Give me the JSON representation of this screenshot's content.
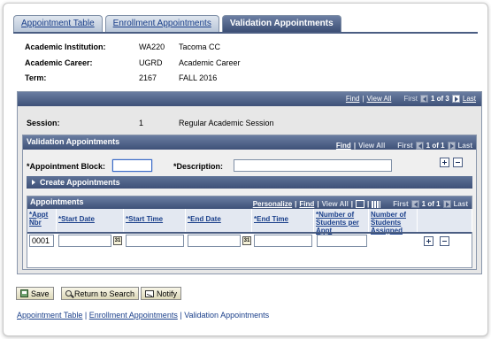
{
  "tabs": [
    {
      "label": "Appointment Table"
    },
    {
      "label": "Enrollment Appointments"
    },
    {
      "label": "Validation Appointments"
    }
  ],
  "header": {
    "institution_label": "Academic Institution:",
    "institution_code": "WA220",
    "institution_name": "Tacoma CC",
    "career_label": "Academic Career:",
    "career_code": "UGRD",
    "career_name": "Academic Career",
    "term_label": "Term:",
    "term_code": "2167",
    "term_name": "FALL 2016"
  },
  "outer_nav": {
    "find": "Find",
    "view_all": "View All",
    "first": "First",
    "count": "1 of 3",
    "last": "Last"
  },
  "session": {
    "label": "Session:",
    "number": "1",
    "description": "Regular Academic Session"
  },
  "validation": {
    "title": "Validation Appointments",
    "nav": {
      "find": "Find",
      "view_all": "View All",
      "first": "First",
      "count": "1 of 1",
      "last": "Last"
    },
    "block_label": "*Appointment Block:",
    "block_value": "",
    "desc_label": "*Description:",
    "desc_value": "",
    "create_label": "Create Appointments"
  },
  "appointments": {
    "title": "Appointments",
    "nav": {
      "personalize": "Personalize",
      "find": "Find",
      "view_all": "View All",
      "first": "First",
      "count": "1 of 1",
      "last": "Last"
    },
    "columns": [
      "*Appt Nbr",
      "*Start Date",
      "*Start Time",
      "*End Date",
      "*End Time",
      "*Number of Students per Appt",
      "Number of Students Assigned"
    ],
    "rows": [
      {
        "appt_nbr": "0001",
        "start_date": "",
        "start_time": "",
        "end_date": "",
        "end_time": "",
        "students_per_appt": "",
        "students_assigned": ""
      }
    ]
  },
  "toolbar": {
    "save": "Save",
    "return": "Return to Search",
    "notify": "Notify"
  },
  "footer": {
    "link1": "Appointment Table",
    "sep": "|",
    "link2": "Enrollment Appointments",
    "current": "Validation Appointments"
  },
  "colors": {
    "bar_dark": "#3e5178",
    "link": "#1a3f8a"
  }
}
